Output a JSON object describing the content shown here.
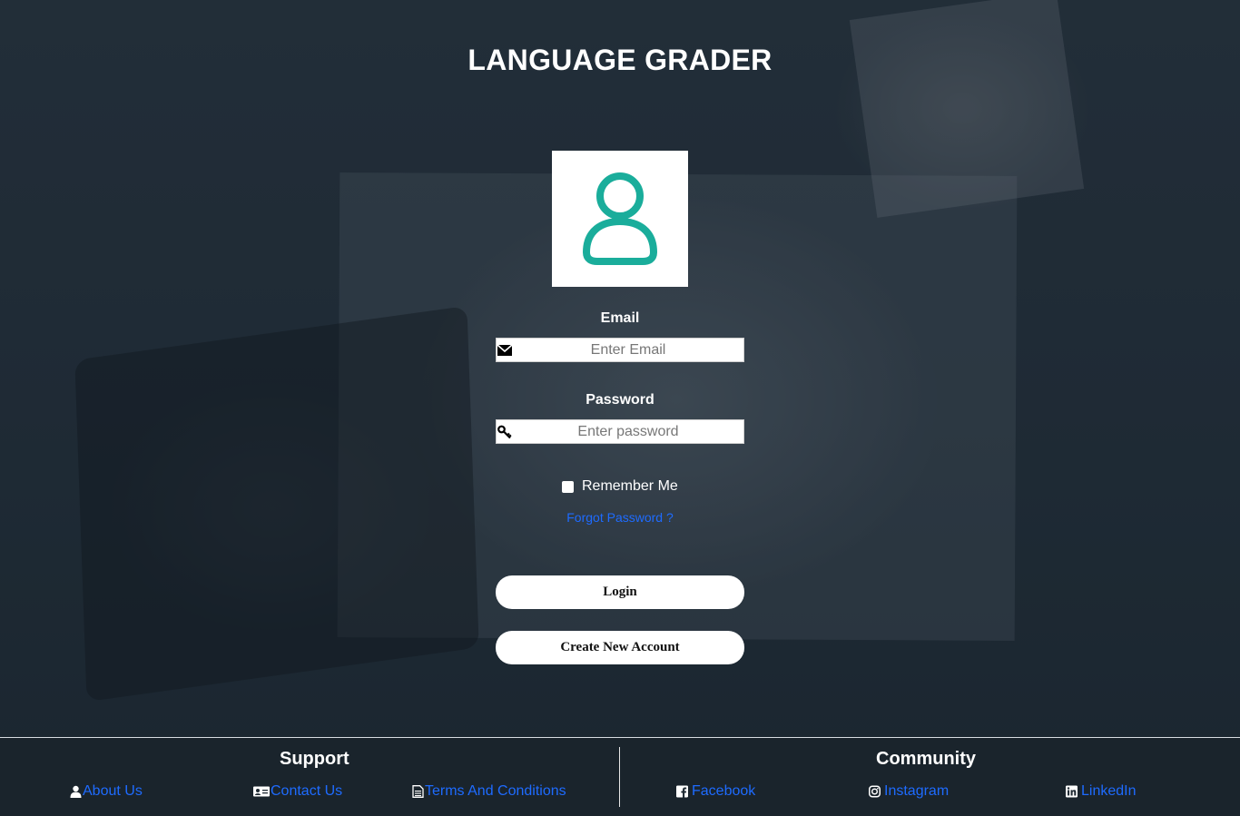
{
  "app": {
    "title": "LANGUAGE GRADER"
  },
  "login_form": {
    "email_label": "Email",
    "email_placeholder": "Enter Email",
    "email_value": "",
    "password_label": "Password",
    "password_placeholder": "Enter password",
    "password_value": "",
    "remember_label": "Remember Me",
    "remember_checked": false,
    "forgot_label": "Forgot Password ?",
    "login_label": "Login",
    "create_label": "Create New Account"
  },
  "footer": {
    "support": {
      "heading": "Support",
      "links": [
        {
          "label": "About Us",
          "icon": "user-icon"
        },
        {
          "label": "Contact Us",
          "icon": "id-card-icon"
        },
        {
          "label": "Terms And Conditions",
          "icon": "document-icon"
        }
      ]
    },
    "community": {
      "heading": "Community",
      "links": [
        {
          "label": "Facebook",
          "icon": "facebook-icon"
        },
        {
          "label": "Instagram",
          "icon": "instagram-icon"
        },
        {
          "label": "LinkedIn",
          "icon": "linkedin-icon"
        }
      ]
    }
  },
  "colors": {
    "accent_teal": "#1aad9b",
    "link_blue": "#1e6bff",
    "text_white": "#ffffff"
  }
}
